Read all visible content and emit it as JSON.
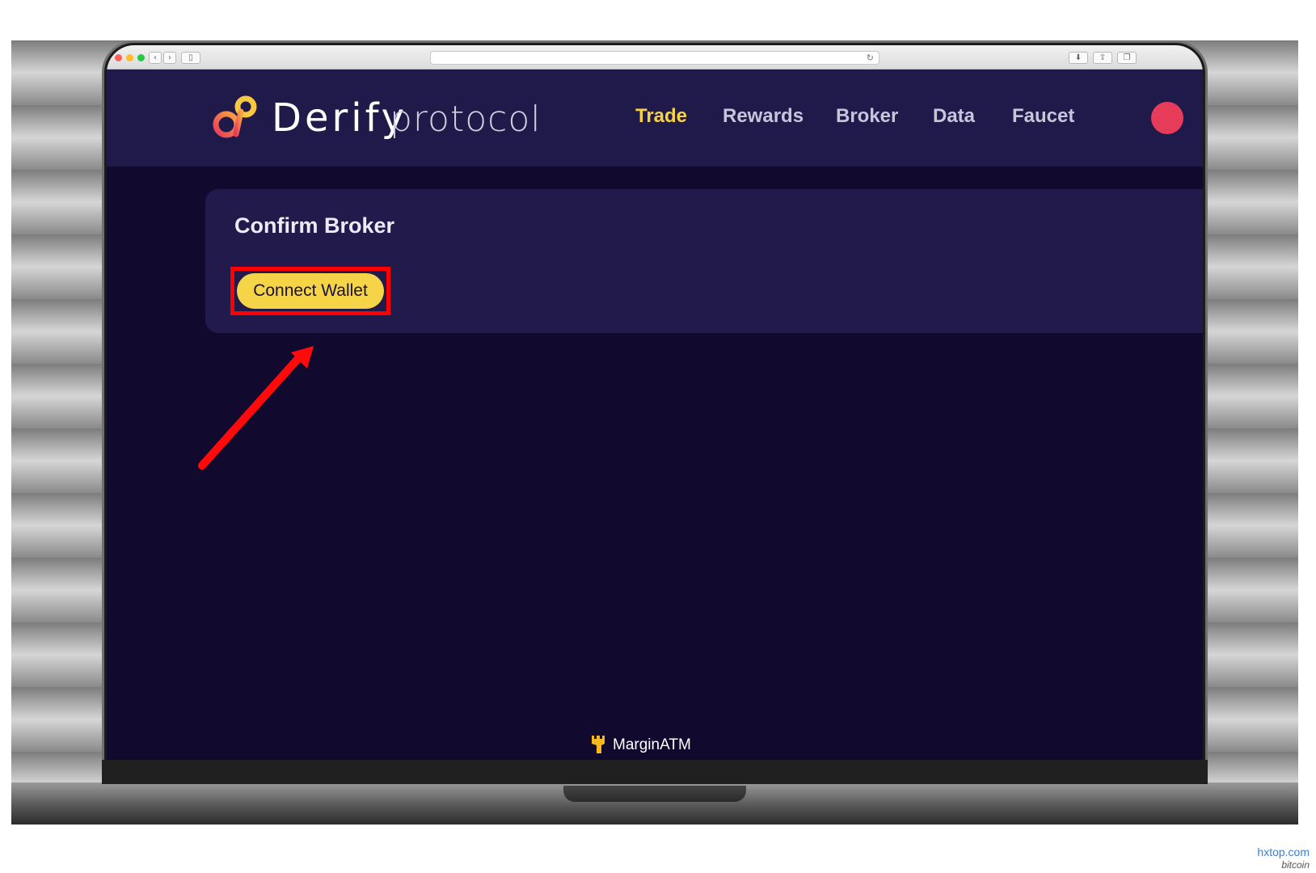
{
  "app": {
    "logo_main": "Derify",
    "logo_sub": "protocol"
  },
  "nav": {
    "items": [
      {
        "label": "Trade",
        "active": true
      },
      {
        "label": "Rewards",
        "active": false
      },
      {
        "label": "Broker",
        "active": false
      },
      {
        "label": "Data",
        "active": false
      },
      {
        "label": "Faucet",
        "active": false
      }
    ]
  },
  "card": {
    "title": "Confirm Broker",
    "button_label": "Connect Wallet"
  },
  "footer": {
    "brand_label": "MarginATM"
  },
  "watermark": {
    "site": "hxtop.com",
    "sub": "bitcoin"
  },
  "colors": {
    "header_bg": "#201a4a",
    "page_bg": "#12092f",
    "accent_yellow": "#f5d547",
    "highlight_red": "#ff0000",
    "logo_pink": "#e73b5a"
  },
  "icons": {
    "logo": "derify-infinity-logo-icon",
    "avatar": "wallet-avatar-icon",
    "brand": "marginatm-castle-icon"
  }
}
